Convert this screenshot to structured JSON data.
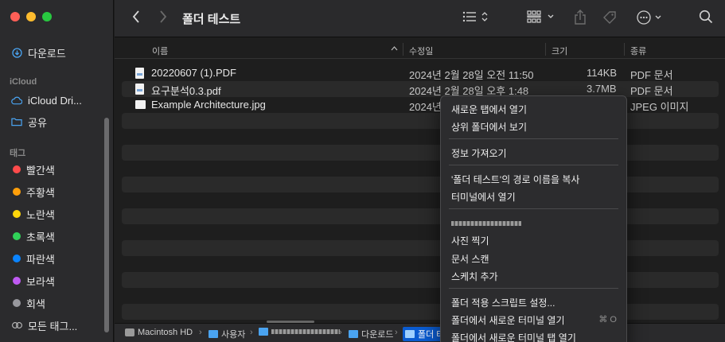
{
  "window": {
    "title": "폴더 테스트"
  },
  "sidebar": {
    "downloads": "다운로드",
    "icloud_header": "iCloud",
    "icloud_drive": "iCloud Dri...",
    "shared": "공유",
    "tags_header": "태그",
    "tags": [
      {
        "label": "빨간색",
        "color": "#fe4b4b"
      },
      {
        "label": "주황색",
        "color": "#ff9f0a"
      },
      {
        "label": "노란색",
        "color": "#ffd60a"
      },
      {
        "label": "초록색",
        "color": "#30d158"
      },
      {
        "label": "파란색",
        "color": "#0a84ff"
      },
      {
        "label": "보라색",
        "color": "#bf5af2"
      },
      {
        "label": "회색",
        "color": "#98989d"
      }
    ],
    "all_tags": "모든 태그..."
  },
  "columns": {
    "name": "이름",
    "modified": "수정일",
    "size": "크기",
    "kind": "종류"
  },
  "files": [
    {
      "name": "20220607 (1).PDF",
      "modified": "2024년 2월 28일 오전 11:50",
      "size": "114KB",
      "kind": "PDF 문서",
      "icon": "pdf-icon"
    },
    {
      "name": "요구분석0.3.pdf",
      "modified": "2024년 2월 28일 오후 1:48",
      "size": "3.7MB",
      "kind": "PDF 문서",
      "icon": "pdf-icon"
    },
    {
      "name": "Example Architecture.jpg",
      "modified": "2024년",
      "size": "",
      "kind": "JPEG 이미지",
      "icon": "image-icon"
    }
  ],
  "pathbar": {
    "disk": "Macintosh HD",
    "users": "사용자",
    "downloads": "다운로드",
    "current": "폴더 테"
  },
  "context_menu": {
    "open_new_tab": "새로운 탭에서 열기",
    "show_enclosing": "상위 폴더에서 보기",
    "get_info": "정보 가져오기",
    "copy_path": "'폴더 테스트'의 경로 이름을 복사",
    "open_terminal": "터미널에서 열기",
    "take_photo": "사진 찍기",
    "scan_docs": "문서 스캔",
    "add_sketch": "스케치 추가",
    "folder_scripts": "폴더 적용 스크립트 설정...",
    "new_terminal": "폴더에서 새로운 터미널 열기",
    "new_terminal_shortcut": "⌘ O",
    "new_terminal_tab": "폴더에서 새로운 터미널 탭 열기"
  }
}
